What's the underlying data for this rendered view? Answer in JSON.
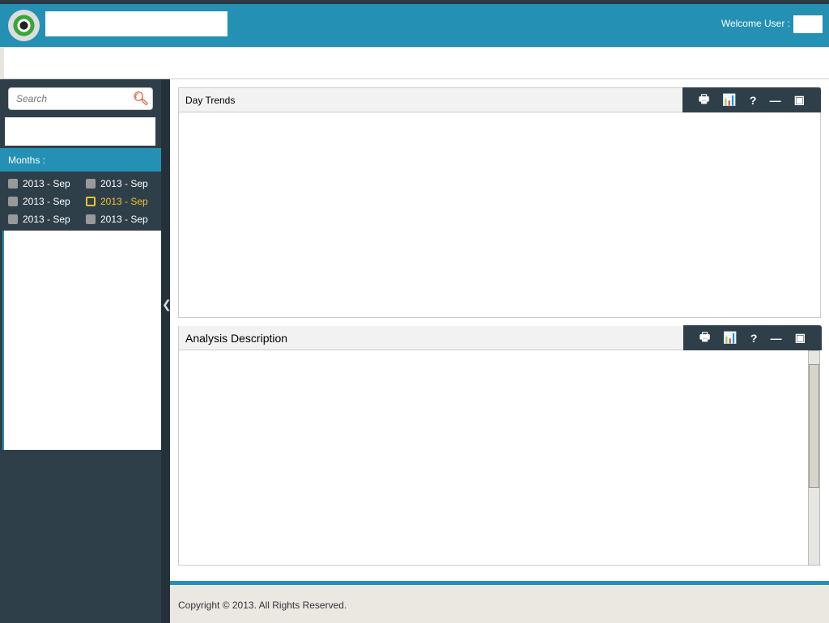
{
  "header": {
    "welcome": "Welcome User :"
  },
  "sidebar": {
    "search_placeholder": "Search",
    "months_label": "Months :",
    "months": [
      "2013 - Sep",
      "2013 - Sep",
      "2013 - Sep",
      "2013 - Sep",
      "2013 - Sep",
      "2013 - Sep"
    ],
    "selected_index": 3
  },
  "panels": [
    {
      "title": "Day Trends"
    },
    {
      "title": "Analysis Description"
    }
  ],
  "tools": {
    "print": "🖶",
    "chart": "📊",
    "help": "?",
    "minimize": "—",
    "maximize": "▣"
  },
  "footer": {
    "text": "Copyright © 2013. All Rights Reserved."
  }
}
